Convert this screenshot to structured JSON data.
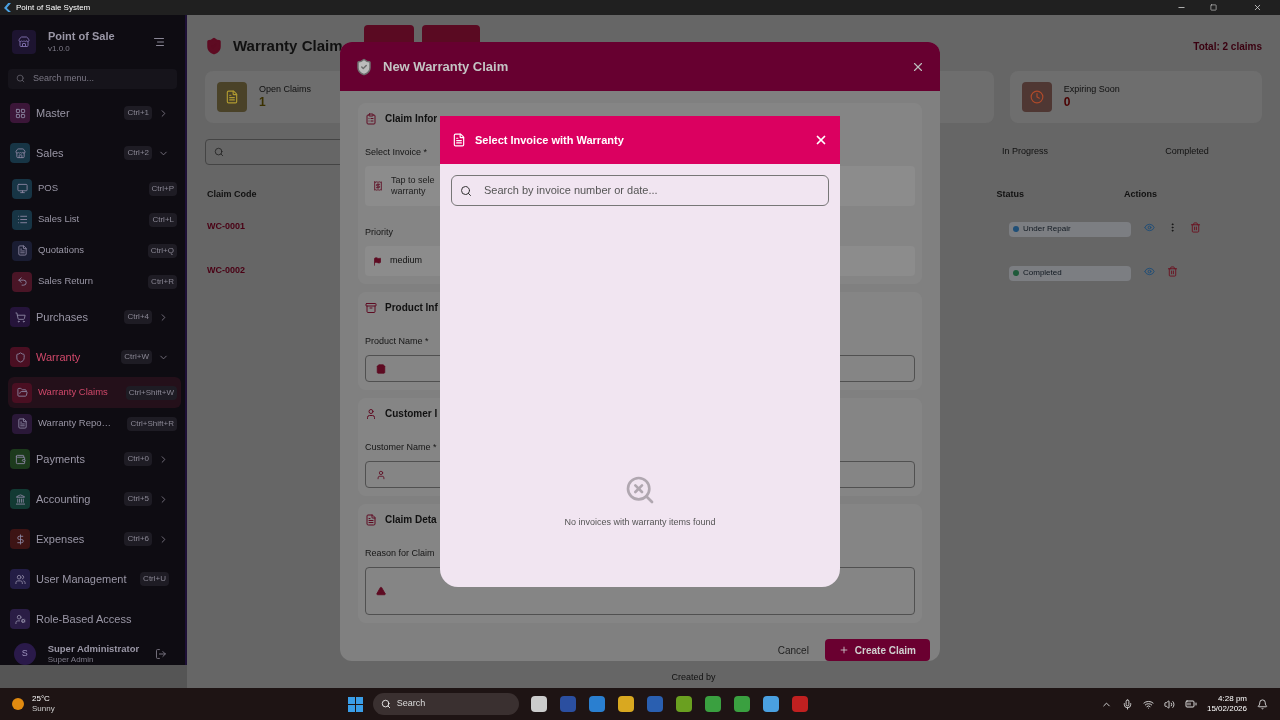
{
  "window": {
    "title": "Point of Sale System"
  },
  "sidebar": {
    "app_name": "Point of Sale",
    "version": "v1.0.0",
    "search": {
      "placeholder": "Search menu..."
    },
    "items": [
      {
        "kind": "group",
        "label": "Master",
        "shortcut": "Ctrl+1",
        "expanded": false,
        "selected": false,
        "color": "#3b1638"
      },
      {
        "kind": "group",
        "label": "Sales",
        "shortcut": "Ctrl+2",
        "expanded": true,
        "selected": false,
        "color": "#173545",
        "children": [
          {
            "label": "POS",
            "shortcut": "Ctrl+P",
            "selected": false,
            "color": "#173545"
          },
          {
            "label": "Sales List",
            "shortcut": "Ctrl+L",
            "selected": false,
            "color": "#173545"
          },
          {
            "label": "Quotations",
            "shortcut": "Ctrl+Q",
            "selected": false,
            "color": "#1a1d33"
          },
          {
            "label": "Sales Return",
            "shortcut": "Ctrl+R",
            "selected": false,
            "color": "#4a1526"
          }
        ]
      },
      {
        "kind": "group",
        "label": "Purchases",
        "shortcut": "Ctrl+4",
        "expanded": false,
        "selected": false,
        "color": "#25143a"
      },
      {
        "kind": "group",
        "label": "Warranty",
        "shortcut": "Ctrl+W",
        "expanded": true,
        "selected": true,
        "color": "#4a0f22",
        "children": [
          {
            "label": "Warranty Claims",
            "shortcut": "Ctrl+Shift+W",
            "selected": true,
            "color": "#4a0f22"
          },
          {
            "label": "Warranty Repo…",
            "shortcut": "Ctrl+Shift+R",
            "selected": false,
            "color": "#2a1838"
          }
        ]
      },
      {
        "kind": "group",
        "label": "Payments",
        "shortcut": "Ctrl+0",
        "expanded": false,
        "selected": false,
        "color": "#1c3a1c"
      },
      {
        "kind": "group",
        "label": "Accounting",
        "shortcut": "Ctrl+5",
        "expanded": false,
        "selected": false,
        "color": "#123a33"
      },
      {
        "kind": "group",
        "label": "Expenses",
        "shortcut": "Ctrl+6",
        "expanded": false,
        "selected": false,
        "color": "#3d1414"
      },
      {
        "kind": "link",
        "label": "User Management",
        "shortcut": "Ctrl+U",
        "selected": false,
        "color": "#231d45"
      },
      {
        "kind": "link",
        "label": "Role-Based Access",
        "selected": false,
        "color": "#2a1d45"
      }
    ],
    "user": {
      "initial": "S",
      "name": "Super Administrator",
      "role": "Super Admin"
    }
  },
  "page": {
    "title": "Warranty Claim",
    "total": "Total: 2 claims",
    "stats": [
      {
        "label": "Open Claims",
        "value": "1",
        "color": "#4a4228"
      },
      {
        "label": "Expiring Soon",
        "value": "0",
        "color": "#4f3733"
      }
    ],
    "tabs": [
      {
        "label": "In Progress",
        "selected": false
      },
      {
        "label": "Completed",
        "selected": false
      }
    ],
    "table": {
      "columns": [
        "Claim Code",
        "Status",
        "Actions"
      ],
      "rows": [
        {
          "code": "WC-0001",
          "status": "Under Repair",
          "color": "#1f4f77",
          "actions": [
            {
              "kind": "view"
            },
            {
              "kind": "more"
            },
            {
              "kind": "delete"
            }
          ]
        },
        {
          "code": "WC-0002",
          "status": "Completed",
          "color": "#1f5a3a",
          "actions": [
            {
              "kind": "view"
            },
            {
              "kind": "delete"
            }
          ]
        }
      ]
    }
  },
  "claim_form": {
    "title": "New Warranty Claim",
    "sections": [
      {
        "kind": "claim",
        "title": "Claim Infor",
        "fields": [
          {
            "kind": "picker",
            "label": "Select Invoice *",
            "lines": [
              "Tap to sele",
              "warranty"
            ]
          },
          {
            "kind": "select",
            "label": "Priority",
            "value": "medium"
          }
        ]
      },
      {
        "kind": "product",
        "title": "Product Inf",
        "fields": [
          {
            "kind": "text",
            "label": "Product Name *"
          }
        ]
      },
      {
        "kind": "customer",
        "title": "Customer I",
        "fields": [
          {
            "kind": "text",
            "label": "Customer Name *"
          }
        ]
      },
      {
        "kind": "details",
        "title": "Claim Deta",
        "fields": [
          {
            "kind": "textarea",
            "label": "Reason for Claim"
          }
        ]
      }
    ],
    "cancel": "Cancel",
    "submit": "Create Claim"
  },
  "invoice_picker": {
    "title": "Select Invoice with Warranty",
    "search": {
      "placeholder": "Search by invoice number or date..."
    },
    "empty_message": "No invoices with warranty items found"
  },
  "footer": {
    "text": "Created by"
  },
  "taskbar": {
    "temperature": "25°C",
    "condition": "Sunny",
    "search": "Search",
    "time": "4:28 pm",
    "date": "15/02/2026"
  }
}
